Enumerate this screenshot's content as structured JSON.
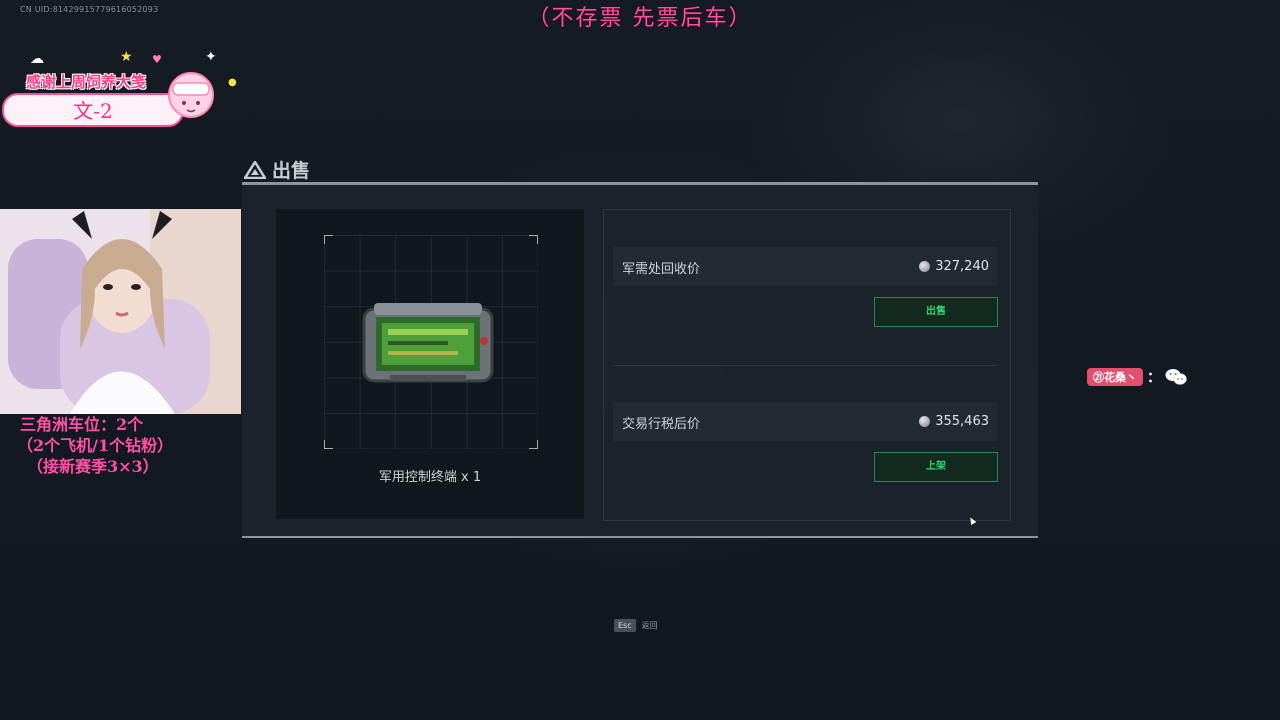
{
  "overlay": {
    "uid": "CN UID:8142991577961605209З",
    "banner": "（不存票 先票后车）",
    "thanks_title": "感谢上周饲养大笺",
    "thanks_name": "文-2",
    "info_lines": [
      "三角洲车位：2个",
      "（2个飞机/1个钻粉）",
      "（接新赛季3×3）"
    ],
    "gift_user": "㉑花桑丶",
    "gift_colon": "："
  },
  "dialog": {
    "title": "出售",
    "item_name": "军用控制终端 x 1",
    "rows": [
      {
        "label": "军需处回收价",
        "value": "327,240",
        "button": "出售"
      },
      {
        "label": "交易行税后价",
        "value": "355,463",
        "button": "上架"
      }
    ]
  },
  "footer": {
    "esc_key": "Esc",
    "esc_label": "返回"
  },
  "colors": {
    "accent_green": "#35d46c",
    "overlay_pink": "#ff4fa6"
  }
}
